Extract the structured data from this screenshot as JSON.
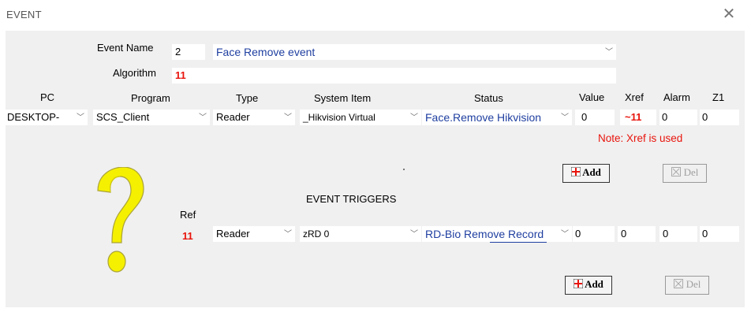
{
  "window": {
    "title": "EVENT"
  },
  "event": {
    "name_label": "Event Name",
    "number": "2",
    "name_value": "Face Remove event",
    "algorithm_label": "Algorithm",
    "algorithm_value": "11"
  },
  "columns": {
    "pc": "PC",
    "program": "Program",
    "type": "Type",
    "system_item": "System Item",
    "status": "Status",
    "value": "Value",
    "xref": "Xref",
    "alarm": "Alarm",
    "z1": "Z1"
  },
  "row": {
    "pc": "DESKTOP-",
    "program": "SCS_Client",
    "type": "Reader",
    "system_item": "_Hikvision Virtual",
    "status": "Face.Remove Hikvision",
    "value": "0",
    "xref": "~11",
    "alarm": "0",
    "z1": "0"
  },
  "note": "Note: Xref is used",
  "buttons": {
    "add": "Add",
    "del": "Del"
  },
  "triggers": {
    "heading": "EVENT TRIGGERS",
    "ref_label": "Ref",
    "ref_value": "11",
    "type": "Reader",
    "system_item": "zRD 0",
    "status": "RD-Bio Remove Record",
    "value": "0",
    "xref": "0",
    "alarm": "0",
    "z1": "0"
  },
  "icons": {
    "help": "question-mark-icon",
    "close": "close-icon",
    "add": "plus-icon",
    "del": "delete-icon",
    "dropdown": "chevron-down-icon"
  },
  "colors": {
    "accent_red": "#e8140c",
    "value_blue": "#1f3fa0",
    "panel": "#f0f0f0",
    "help_yellow": "#f5f000"
  }
}
